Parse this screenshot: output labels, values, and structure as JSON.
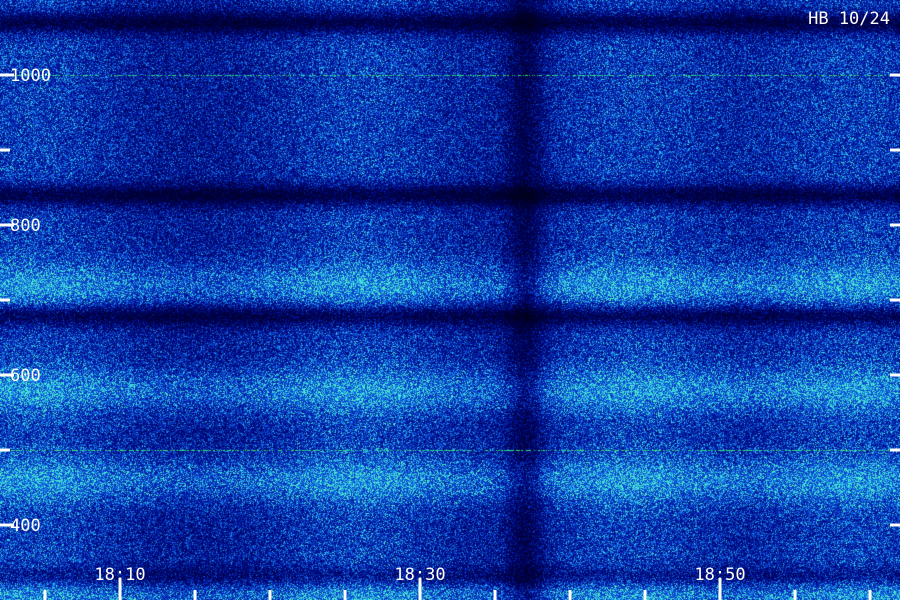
{
  "chart_data": {
    "type": "heatmap",
    "title": "HB 10/24",
    "xlabel": "",
    "ylabel": "",
    "x_tick_labels": [
      "18:10",
      "18:30",
      "18:50"
    ],
    "x_ticks_minutes": [
      10,
      30,
      50
    ],
    "x_range_minutes": [
      2,
      62
    ],
    "y_tick_labels": [
      "1000",
      "800",
      "600",
      "400"
    ],
    "y_ticks": [
      1000,
      800,
      600,
      400
    ],
    "y_range": [
      300,
      1100
    ],
    "grid": false,
    "colormap": [
      "#000000",
      "#000040",
      "#000c8c",
      "#0a3cc8",
      "#147ae6",
      "#28b4f0",
      "#50f0c8"
    ],
    "lines": [
      {
        "y": 1000,
        "color": "#2ee07a"
      },
      {
        "y": 500,
        "color": "#2ee07a"
      }
    ],
    "bright_bands_y": [
      720,
      580,
      460,
      310
    ],
    "dark_bands_y": [
      1070,
      840,
      680,
      330
    ],
    "bright_times_minutes": [
      4,
      26,
      44,
      59
    ],
    "dark_times_minutes": [
      37
    ]
  }
}
